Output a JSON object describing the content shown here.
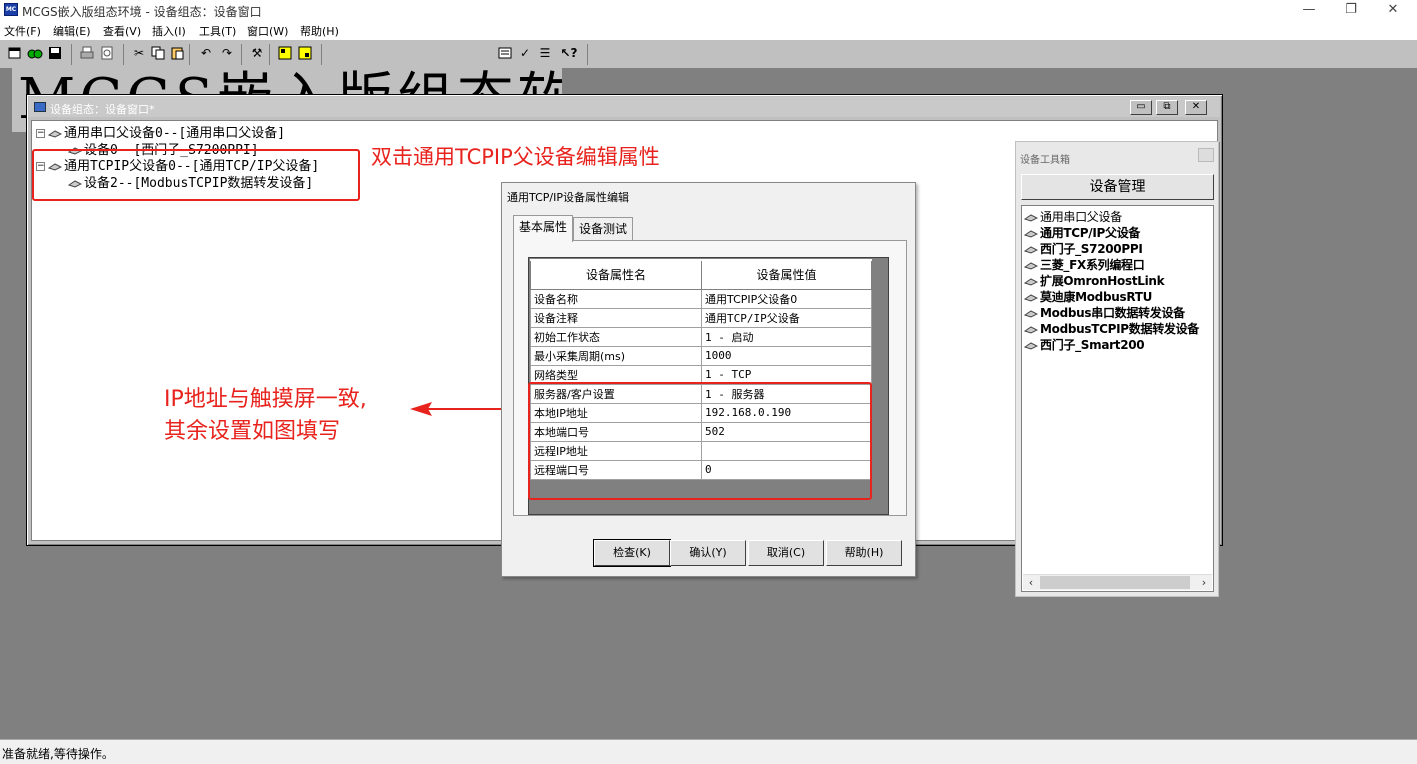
{
  "window": {
    "title": "MCGS嵌入版组态环境 - 设备组态：设备窗口",
    "controls": [
      "—",
      "❐",
      "✕"
    ]
  },
  "menubar": {
    "items": [
      "文件(F)",
      "编辑(E)",
      "查看(V)",
      "插入(I)",
      "工具(T)",
      "窗口(W)",
      "帮助(H)"
    ]
  },
  "banner": {
    "text": "MCGS嵌入版组态软件"
  },
  "device_window": {
    "title": "设备组态：设备窗口*",
    "tree": [
      {
        "text": "通用串口父设备0--[通用串口父设备]",
        "expander": "⊟"
      },
      {
        "text": "设备0--[西门子_S7200PPI]"
      },
      {
        "text": "通用TCPIP父设备0--[通用TCP/IP父设备]",
        "expander": "⊟"
      },
      {
        "text": "设备2--[ModbusTCPIP数据转发设备]"
      }
    ]
  },
  "annotations": {
    "top": "双击通用TCPIP父设备编辑属性",
    "left_line1": "IP地址与触摸屏一致,",
    "left_line2": "其余设置如图填写"
  },
  "dialog": {
    "title": "通用TCP/IP设备属性编辑",
    "tabs": [
      "基本属性",
      "设备测试"
    ],
    "col_headers": [
      "设备属性名",
      "设备属性值"
    ],
    "rows": [
      {
        "name": "设备名称",
        "value": "通用TCPIP父设备0"
      },
      {
        "name": "设备注释",
        "value": "通用TCP/IP父设备"
      },
      {
        "name": "初始工作状态",
        "value": "1 - 启动"
      },
      {
        "name": "最小采集周期(ms)",
        "value": "1000"
      },
      {
        "name": "网络类型",
        "value": "1 - TCP"
      },
      {
        "name": "服务器/客户设置",
        "value": "1 - 服务器"
      },
      {
        "name": "本地IP地址",
        "value": "192.168.0.190"
      },
      {
        "name": "本地端口号",
        "value": "502"
      },
      {
        "name": "远程IP地址",
        "value": ""
      },
      {
        "name": "远程端口号",
        "value": "0"
      }
    ],
    "buttons": [
      "检查(K)",
      "确认(Y)",
      "取消(C)",
      "帮助(H)"
    ]
  },
  "toolbox": {
    "title": "设备工具箱",
    "manage_button": "设备管理",
    "items": [
      "通用串口父设备",
      "通用TCP/IP父设备",
      "西门子_S7200PPI",
      "三菱_FX系列编程口",
      "扩展OmronHostLink",
      "莫迪康ModbusRTU",
      "Modbus串口数据转发设备",
      "ModbusTCPIP数据转发设备",
      "西门子_Smart200"
    ]
  },
  "statusbar": {
    "text": "准备就绪,等待操作。"
  },
  "colors": {
    "annotation_red": "#e8221c",
    "workspace_gray": "#808080"
  }
}
